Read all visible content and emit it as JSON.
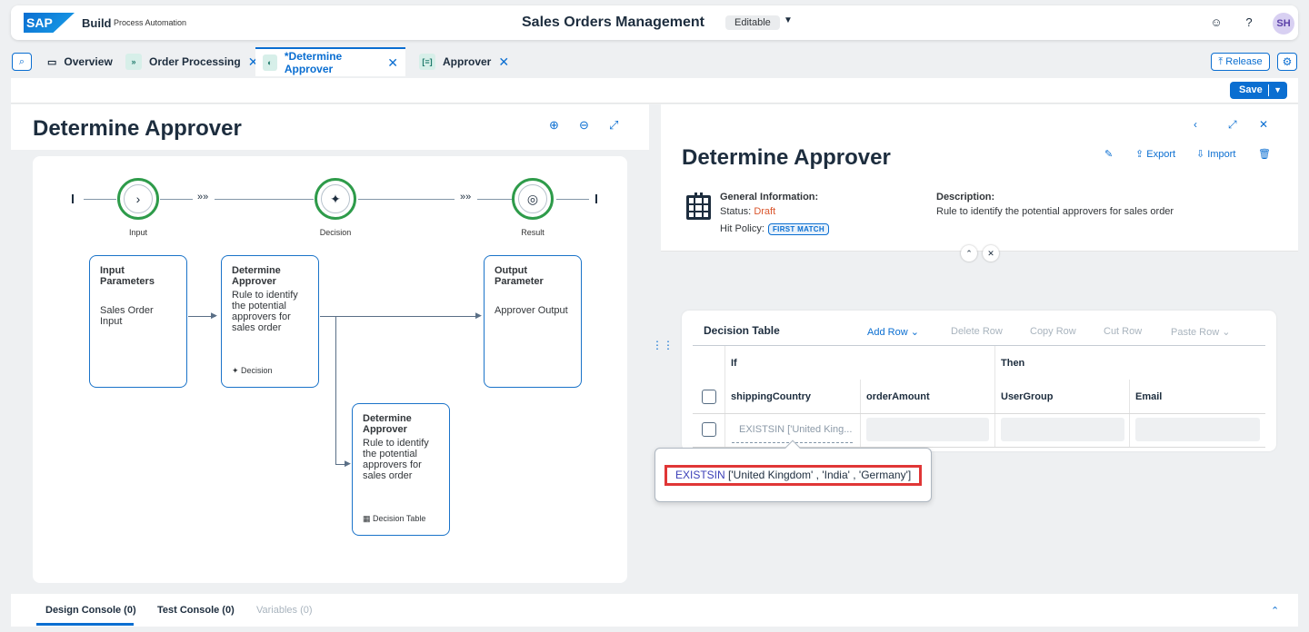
{
  "shell": {
    "logo": "SAP",
    "brand": "Build",
    "product": "Process Automation",
    "app_title": "Sales Orders Management",
    "status": "Editable",
    "avatar": "SH"
  },
  "tabs": [
    {
      "label": "Overview",
      "icon": "folder-icon"
    },
    {
      "label": "Order Processing",
      "icon": "process-icon"
    },
    {
      "label": "*Determine Approver",
      "icon": "decision-icon"
    },
    {
      "label": "Approver",
      "icon": "rule-icon"
    }
  ],
  "toolbar": {
    "release": "Release",
    "save": "Save"
  },
  "left": {
    "title": "Determine Approver",
    "flow_nodes": [
      {
        "label": "Input"
      },
      {
        "label": "Decision"
      },
      {
        "label": "Result"
      }
    ],
    "cards": {
      "input": {
        "title": "Input Parameters",
        "desc": "Sales Order Input"
      },
      "decision": {
        "title": "Determine Approver",
        "desc": "Rule to identify the potential approvers for sales order",
        "footer": "Decision"
      },
      "output": {
        "title": "Output Parameter",
        "desc": "Approver Output"
      },
      "table": {
        "title": "Determine Approver",
        "desc": "Rule to identify the potential approvers for sales order",
        "footer": "Decision Table"
      }
    }
  },
  "right": {
    "title": "Determine Approver",
    "actions": {
      "export": "Export",
      "import": "Import"
    },
    "general_info_label": "General Information:",
    "status_label": "Status:",
    "status_value": "Draft",
    "hit_policy_label": "Hit Policy:",
    "hit_policy_value": "FIRST MATCH",
    "description_label": "Description:",
    "description_value": "Rule to identify the potential approvers for sales order"
  },
  "decision_table": {
    "caption": "Decision Table",
    "buttons": [
      "Add Row",
      "Delete Row",
      "Copy Row",
      "Cut Row",
      "Paste Row"
    ],
    "if_label": "If",
    "then_label": "Then",
    "columns": [
      "shippingCountry",
      "orderAmount",
      "UserGroup",
      "Email"
    ],
    "row1_cell": "EXISTSIN ['United King...",
    "suggestion_keyword": "EXISTSIN",
    "suggestion_rest": " ['United Kingdom' , 'India' , 'Germany']"
  },
  "console": {
    "tabs": [
      "Design Console (0)",
      "Test Console (0)",
      "Variables (0)"
    ]
  },
  "colors": {
    "accent": "#0a6ed1",
    "success": "#2e9b4a",
    "draft": "#d9552c",
    "highlight": "#e03636"
  }
}
